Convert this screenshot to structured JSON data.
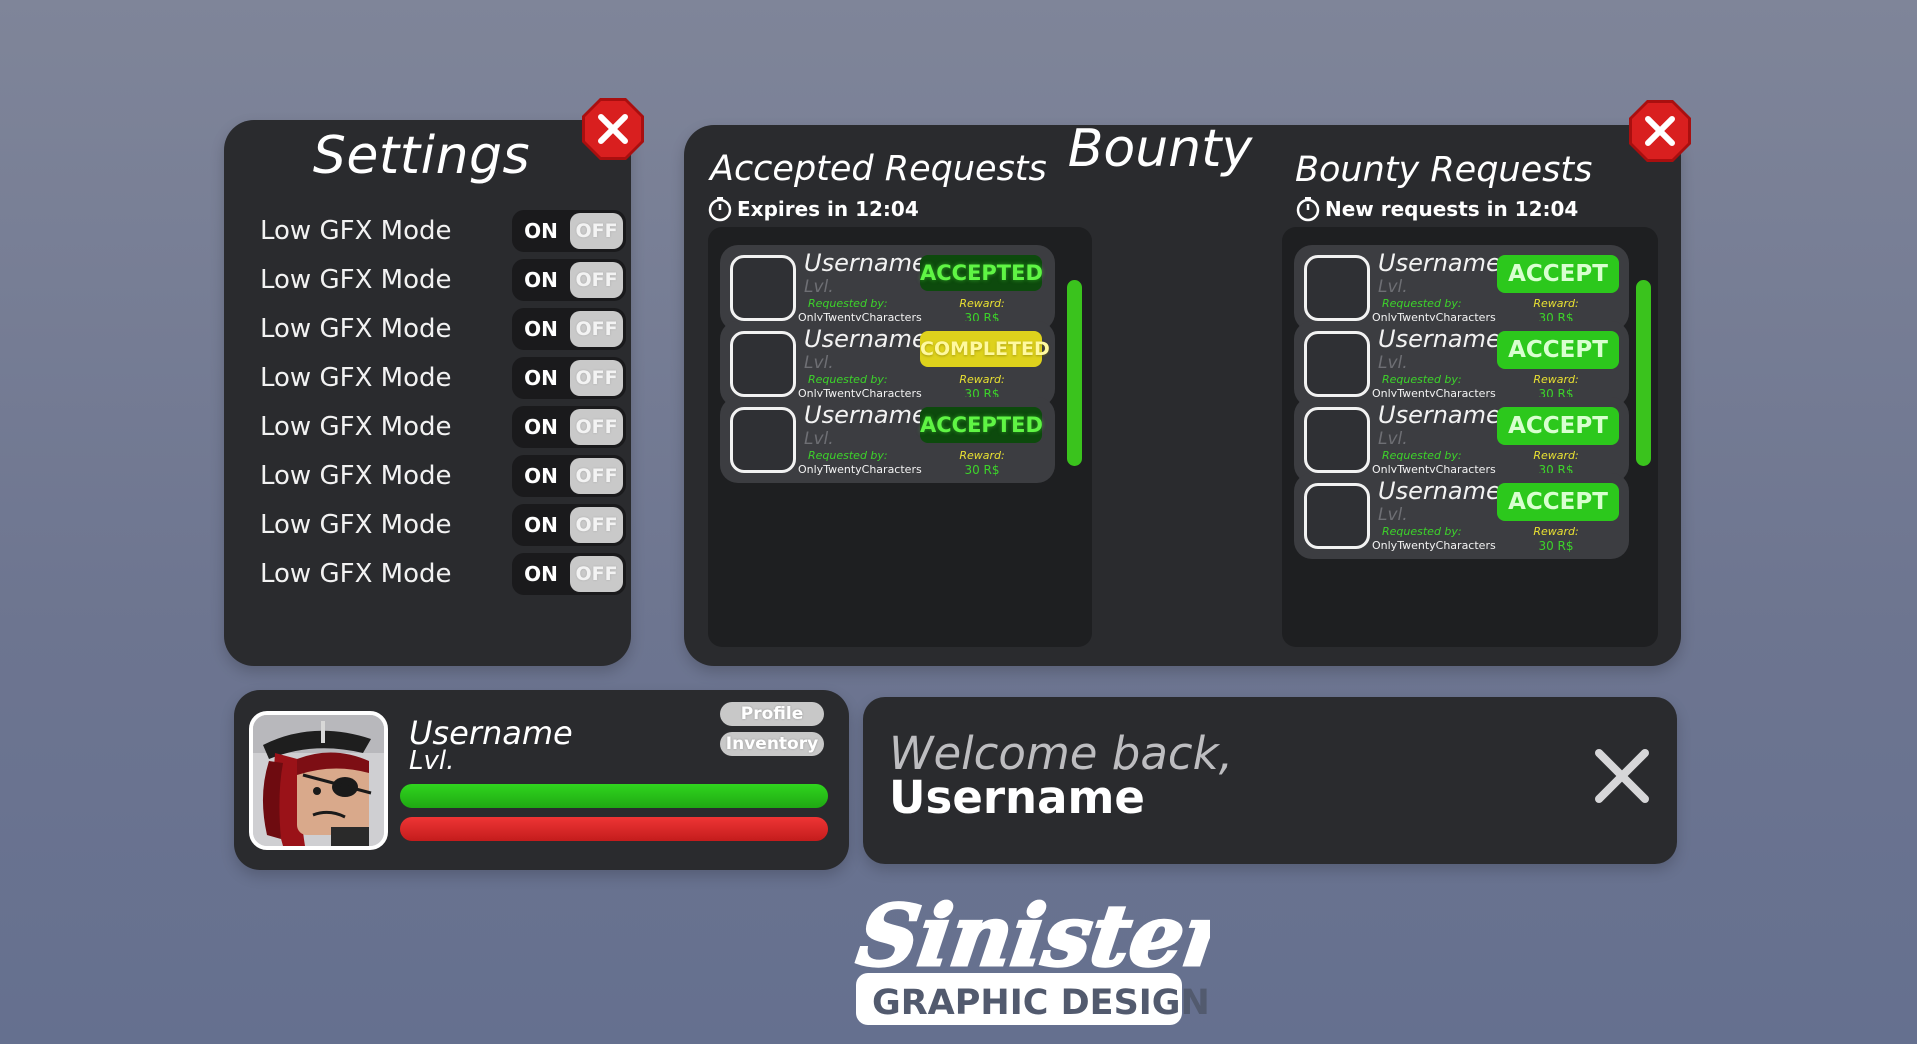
{
  "colors": {
    "panel": "#2a2b2e",
    "green": "#2cc81c",
    "yellow": "#ded21c",
    "close_red": "#d11a1a",
    "health_red": "#dd2b2b"
  },
  "settings": {
    "title": "Settings",
    "rows": [
      {
        "label": "Low GFX Mode",
        "on": "ON",
        "off": "OFF"
      },
      {
        "label": "Low GFX Mode",
        "on": "ON",
        "off": "OFF"
      },
      {
        "label": "Low GFX Mode",
        "on": "ON",
        "off": "OFF"
      },
      {
        "label": "Low GFX Mode",
        "on": "ON",
        "off": "OFF"
      },
      {
        "label": "Low GFX Mode",
        "on": "ON",
        "off": "OFF"
      },
      {
        "label": "Low GFX Mode",
        "on": "ON",
        "off": "OFF"
      },
      {
        "label": "Low GFX Mode",
        "on": "ON",
        "off": "OFF"
      },
      {
        "label": "Low GFX Mode",
        "on": "ON",
        "off": "OFF"
      }
    ],
    "close_icon": "close-icon"
  },
  "bounty": {
    "title": "Bounty",
    "accepted": {
      "title": "Accepted Requests",
      "timer": "Expires in 12:04",
      "cards": [
        {
          "username": "Username",
          "lvl": "Lvl.",
          "req_label": "Requested by:",
          "req_name": "OnlyTwentyCharacters",
          "reward_label": "Reward:",
          "reward": "30 R$",
          "status": "ACCEPTED",
          "status_type": "accepted"
        },
        {
          "username": "Username",
          "lvl": "Lvl.",
          "req_label": "Requested by:",
          "req_name": "OnlyTwentyCharacters",
          "reward_label": "Reward:",
          "reward": "30 R$",
          "status": "COMPLETED",
          "status_type": "completed"
        },
        {
          "username": "Username",
          "lvl": "Lvl.",
          "req_label": "Requested by:",
          "req_name": "OnlyTwentyCharacters",
          "reward_label": "Reward:",
          "reward": "30 R$",
          "status": "ACCEPTED",
          "status_type": "accepted"
        }
      ]
    },
    "requests": {
      "title": "Bounty Requests",
      "timer": "New requests in 12:04",
      "cards": [
        {
          "username": "Username",
          "lvl": "Lvl.",
          "req_label": "Requested by:",
          "req_name": "OnlyTwentyCharacters",
          "reward_label": "Reward:",
          "reward": "30 R$",
          "button": "ACCEPT"
        },
        {
          "username": "Username",
          "lvl": "Lvl.",
          "req_label": "Requested by:",
          "req_name": "OnlyTwentyCharacters",
          "reward_label": "Reward:",
          "reward": "30 R$",
          "button": "ACCEPT"
        },
        {
          "username": "Username",
          "lvl": "Lvl.",
          "req_label": "Requested by:",
          "req_name": "OnlyTwentyCharacters",
          "reward_label": "Reward:",
          "reward": "30 R$",
          "button": "ACCEPT"
        },
        {
          "username": "Username",
          "lvl": "Lvl.",
          "req_label": "Requested by:",
          "req_name": "OnlyTwentyCharacters",
          "reward_label": "Reward:",
          "reward": "30 R$",
          "button": "ACCEPT"
        }
      ]
    }
  },
  "profile": {
    "username": "Username",
    "lvl": "Lvl.",
    "profile_button": "Profile",
    "inventory_button": "Inventory",
    "xp_fill": 1.0,
    "health_fill": 1.0
  },
  "welcome": {
    "line1": "Welcome back,",
    "line2": "Username"
  },
  "logo": {
    "name": "Sinister",
    "tagline": "GRAPHIC DESIGNER"
  }
}
